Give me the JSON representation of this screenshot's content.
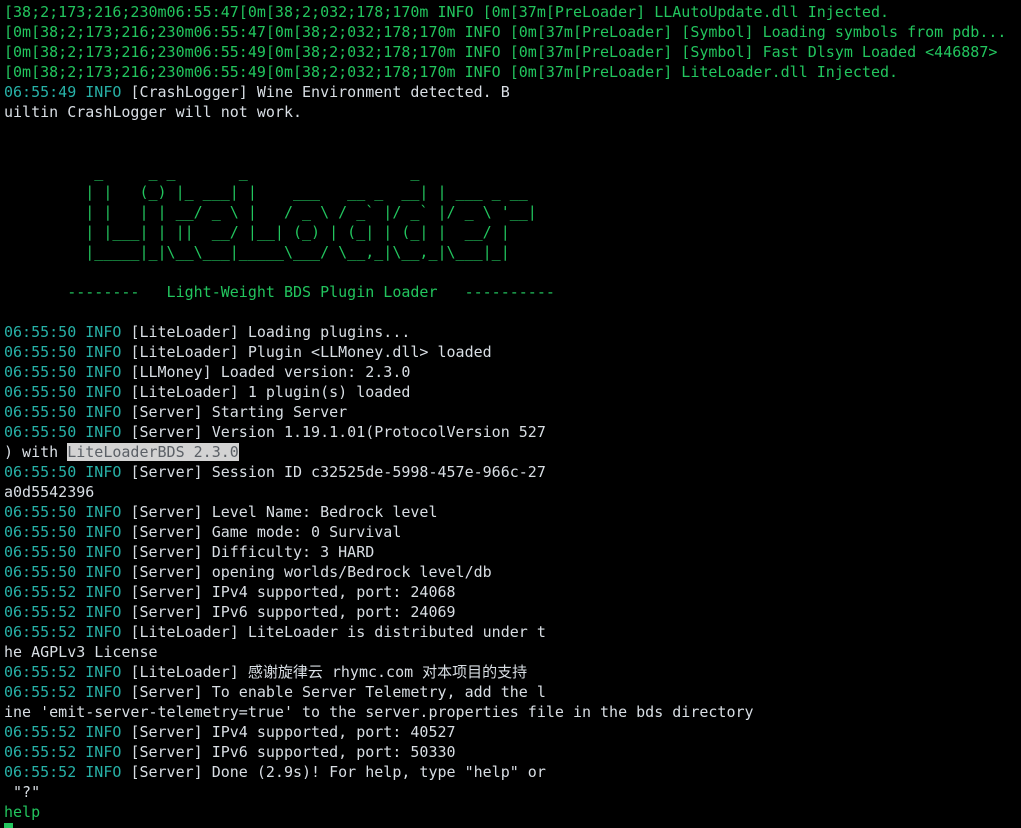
{
  "colors": {
    "background": "#000000",
    "text": "#d8dee4",
    "green": "#22c55e",
    "timestamp": "#27b2a8",
    "highlight_bg": "#d3d3d3"
  },
  "raw_lines": [
    "[38;2;173;216;230m06:55:47[0m[38;2;032;178;170m INFO [0m[37m[PreLoader] LLAutoUpdate.dll Injected.",
    "[0m[38;2;173;216;230m06:55:47[0m[38;2;032;178;170m INFO [0m[37m[PreLoader] [Symbol] Loading symbols from pdb...",
    "[0m[38;2;173;216;230m06:55:49[0m[38;2;032;178;170m INFO [0m[37m[PreLoader] [Symbol] Fast Dlsym Loaded <446887>",
    "[0m[38;2;173;216;230m06:55:49[0m[38;2;032;178;170m INFO [0m[37m[PreLoader] LiteLoader.dll Injected."
  ],
  "crash": {
    "ts": "06:55:49",
    "level": "INFO",
    "msg": "[CrashLogger] Wine Environment detected. B",
    "wrap": "uiltin CrashLogger will not work."
  },
  "banner": [
    "          _     _ _       _                  _",
    "         | |   (_) |_ ___| |    ___   __ _  __| | ___ _ __",
    "         | |   | | __/ _ \\ |   / _ \\ / _` |/ _` |/ _ \\ '__|",
    "         | |___| | ||  __/ |__| (_) | (_| | (_| |  __/ |",
    "         |_____|_|\\__\\___|_____\\___/ \\__,_|\\__,_|\\___|_|"
  ],
  "subtitle": "       --------   Light-Weight BDS Plugin Loader   ----------",
  "logs": [
    {
      "ts": "06:55:50",
      "level": "INFO",
      "msg": "[LiteLoader] Loading plugins..."
    },
    {
      "ts": "06:55:50",
      "level": "INFO",
      "msg": "[LiteLoader] Plugin <LLMoney.dll> loaded"
    },
    {
      "ts": "06:55:50",
      "level": "INFO",
      "msg": "[LLMoney] Loaded version: 2.3.0"
    },
    {
      "ts": "06:55:50",
      "level": "INFO",
      "msg": "[LiteLoader] 1 plugin(s) loaded"
    },
    {
      "ts": "06:55:50",
      "level": "INFO",
      "msg": "[Server] Starting Server"
    },
    {
      "ts": "06:55:50",
      "level": "INFO",
      "msg": "[Server] Version 1.19.1.01(ProtocolVersion 527"
    }
  ],
  "version_wrap": {
    "prefix": ") with ",
    "highlight": "LiteLoaderBDS 2.3.0"
  },
  "logs2": [
    {
      "ts": "06:55:50",
      "level": "INFO",
      "msg": "[Server] Session ID c32525de-5998-457e-966c-27"
    }
  ],
  "session_wrap": "a0d5542396",
  "logs3": [
    {
      "ts": "06:55:50",
      "level": "INFO",
      "msg": "[Server] Level Name: Bedrock level"
    },
    {
      "ts": "06:55:50",
      "level": "INFO",
      "msg": "[Server] Game mode: 0 Survival"
    },
    {
      "ts": "06:55:50",
      "level": "INFO",
      "msg": "[Server] Difficulty: 3 HARD"
    },
    {
      "ts": "06:55:50",
      "level": "INFO",
      "msg": "[Server] opening worlds/Bedrock level/db"
    },
    {
      "ts": "06:55:52",
      "level": "INFO",
      "msg": "[Server] IPv4 supported, port: 24068"
    },
    {
      "ts": "06:55:52",
      "level": "INFO",
      "msg": "[Server] IPv6 supported, port: 24069"
    },
    {
      "ts": "06:55:52",
      "level": "INFO",
      "msg": "[LiteLoader] LiteLoader is distributed under t"
    }
  ],
  "license_wrap": "he AGPLv3 License",
  "logs4": [
    {
      "ts": "06:55:52",
      "level": "INFO",
      "msg": "[LiteLoader] 感谢旋律云 rhymc.com 对本项目的支持"
    },
    {
      "ts": "06:55:52",
      "level": "INFO",
      "msg": "[Server] To enable Server Telemetry, add the l"
    }
  ],
  "telemetry_wrap": "ine 'emit-server-telemetry=true' to the server.properties file in the bds directory",
  "logs5": [
    {
      "ts": "06:55:52",
      "level": "INFO",
      "msg": "[Server] IPv4 supported, port: 40527"
    },
    {
      "ts": "06:55:52",
      "level": "INFO",
      "msg": "[Server] IPv6 supported, port: 50330"
    },
    {
      "ts": "06:55:52",
      "level": "INFO",
      "msg": "[Server] Done (2.9s)! For help, type \"help\" or"
    }
  ],
  "done_wrap": " \"?\"",
  "input": {
    "typed": "help"
  }
}
